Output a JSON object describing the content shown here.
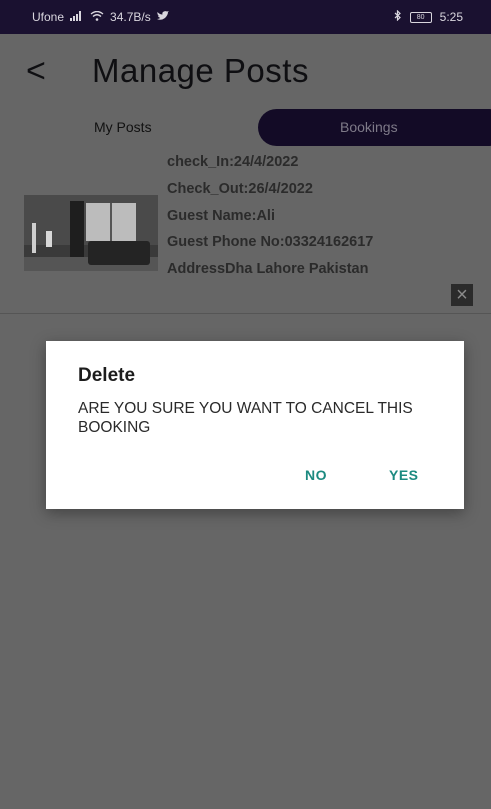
{
  "status_bar": {
    "carrier": "Ufone",
    "signal_icon": "signal-icon",
    "wifi_icon": "wifi-icon",
    "speed": "34.7B/s",
    "twitter_icon": "twitter-icon",
    "bluetooth_icon": "bluetooth-icon",
    "battery_level": "80",
    "time": "5:25"
  },
  "header": {
    "back_icon": "back-chevron-icon",
    "title": "Manage Posts"
  },
  "tabs": {
    "my_posts_label": "My Posts",
    "bookings_label": "Bookings"
  },
  "booking": {
    "check_in": "check_In:24/4/2022",
    "check_out": "Check_Out:26/4/2022",
    "guest_name": "Guest Name:Ali",
    "guest_phone": "Guest Phone No:03324162617",
    "address": "AddressDha Lahore Pakistan",
    "remove_icon": "close-icon",
    "image_description": "hotel-room-thumbnail"
  },
  "dialog": {
    "title": "Delete",
    "message": "ARE YOU SURE YOU WANT TO CANCEL THIS BOOKING",
    "no_label": "NO",
    "yes_label": "YES"
  },
  "colors": {
    "overlay_bg": "#666666",
    "status_bar_bg": "#1a1130",
    "tab_active_bg": "#130b26",
    "dialog_button": "#1c8a80"
  }
}
